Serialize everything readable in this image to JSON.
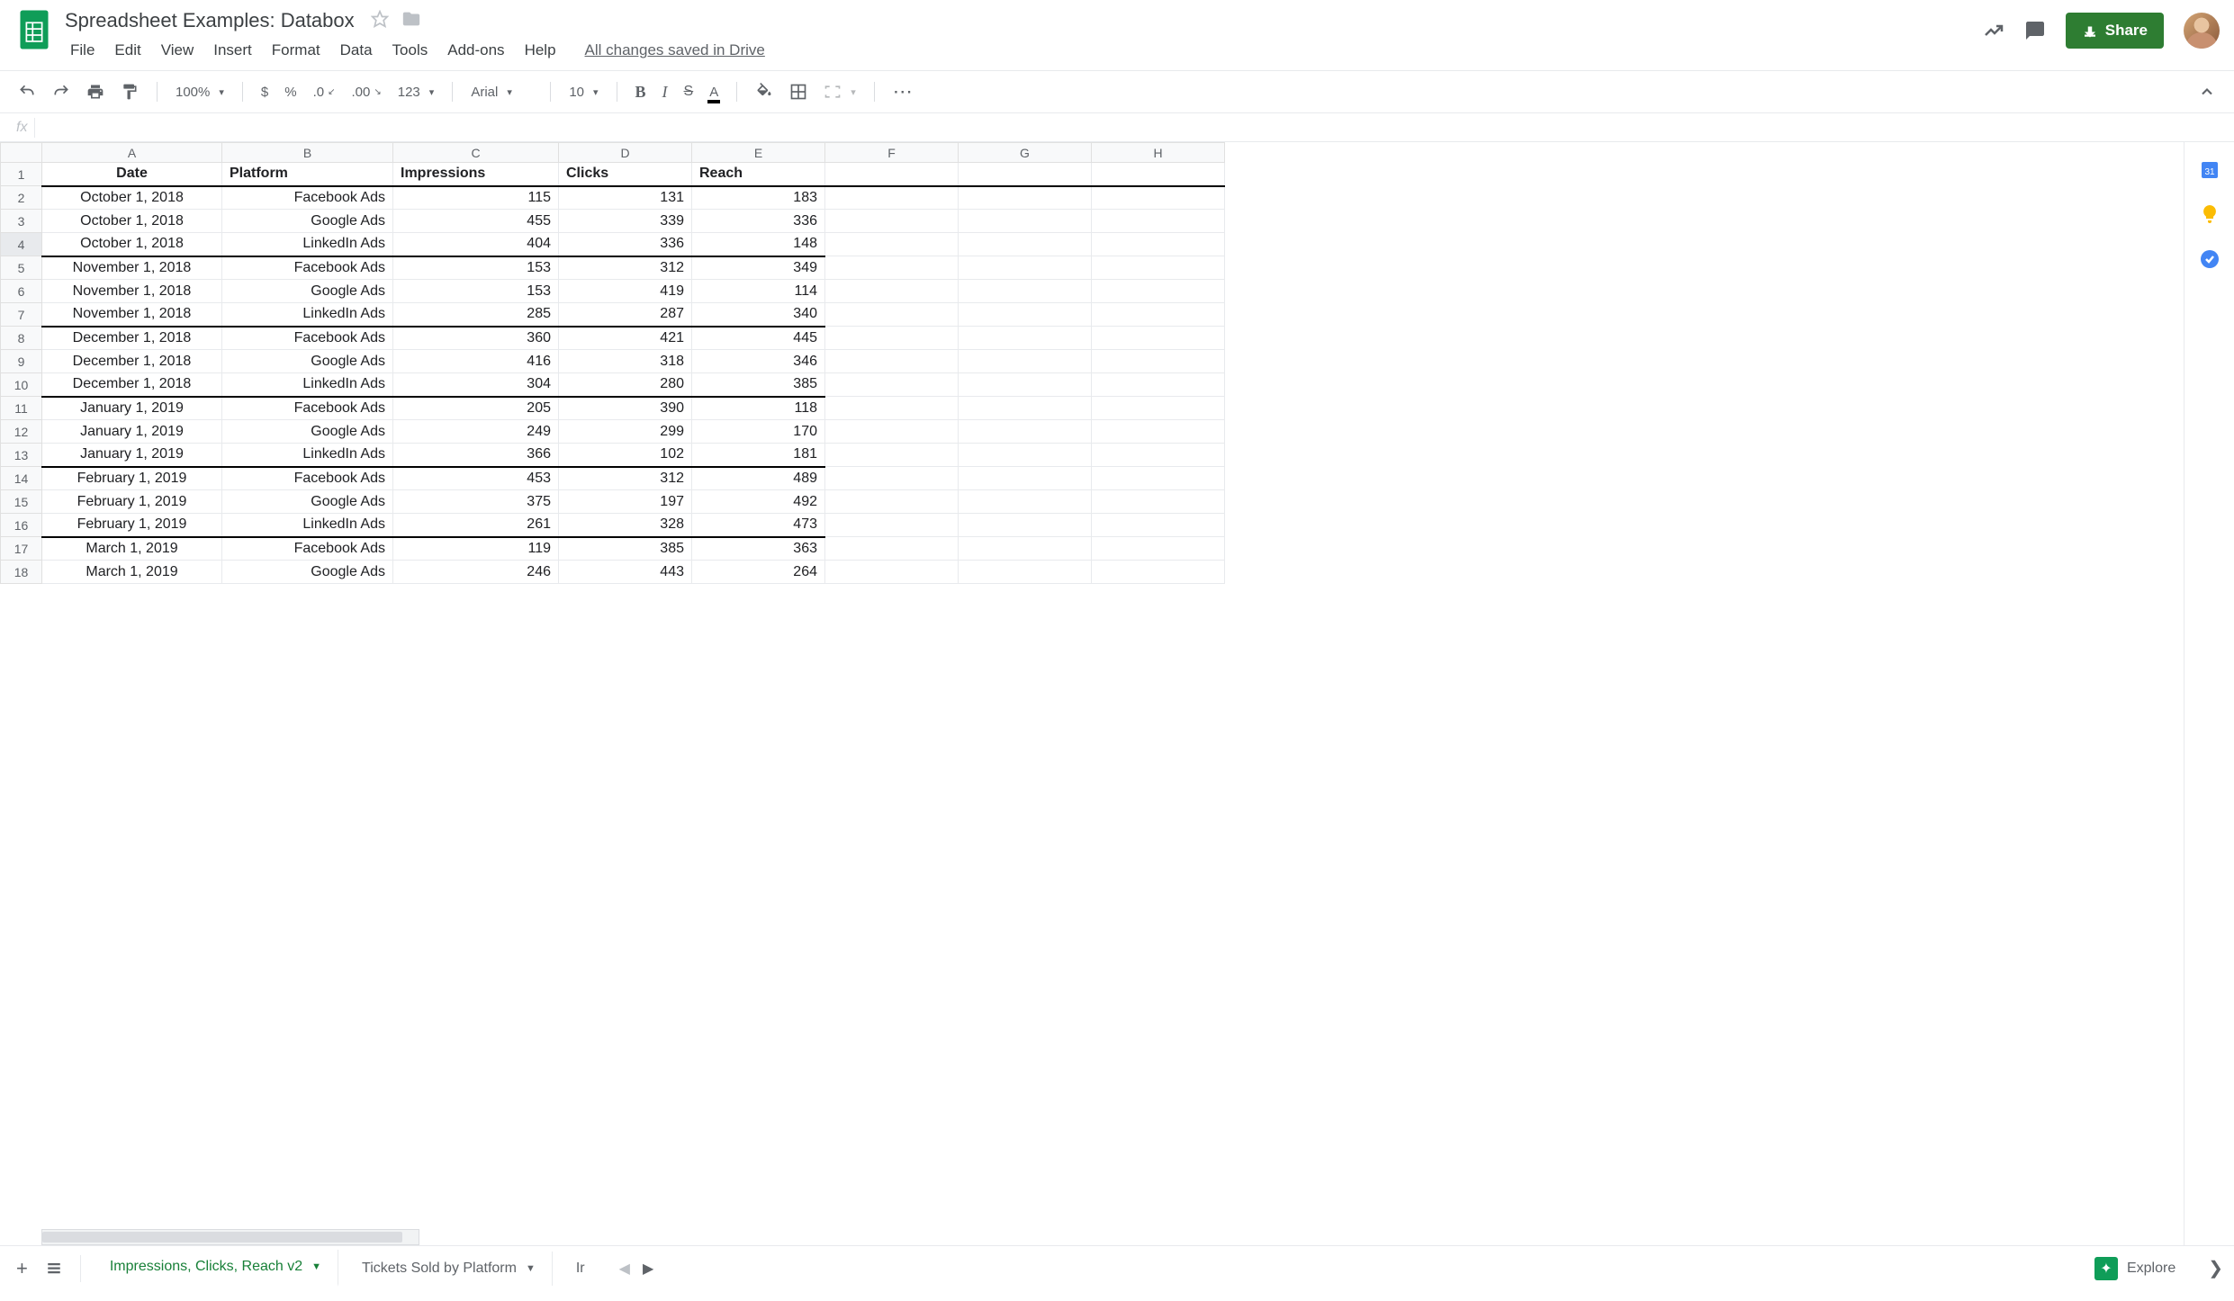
{
  "header": {
    "title": "Spreadsheet Examples: Databox",
    "saved_status": "All changes saved in Drive",
    "share_label": "Share"
  },
  "menu": [
    "File",
    "Edit",
    "View",
    "Insert",
    "Format",
    "Data",
    "Tools",
    "Add-ons",
    "Help"
  ],
  "toolbar": {
    "zoom": "100%",
    "currency": "$",
    "percent": "%",
    "dec_dec": ".0",
    "inc_dec": ".00",
    "num_fmt": "123",
    "font": "Arial",
    "size": "10",
    "more": "⋯"
  },
  "formula_bar": {
    "symbol": "fx",
    "value": ""
  },
  "columns": [
    "A",
    "B",
    "C",
    "D",
    "E",
    "F",
    "G",
    "H"
  ],
  "headers": [
    "Date",
    "Platform",
    "Impressions",
    "Clicks",
    "Reach"
  ],
  "rows": [
    {
      "n": 1,
      "hdr": true
    },
    {
      "n": 2,
      "d": "October 1, 2018",
      "p": "Facebook Ads",
      "i": 115,
      "c": 131,
      "r": 183
    },
    {
      "n": 3,
      "d": "October 1, 2018",
      "p": "Google Ads",
      "i": 455,
      "c": 339,
      "r": 336
    },
    {
      "n": 4,
      "d": "October 1, 2018",
      "p": "LinkedIn Ads",
      "i": 404,
      "c": 336,
      "r": 148,
      "ge": true
    },
    {
      "n": 5,
      "d": "November 1, 2018",
      "p": "Facebook Ads",
      "i": 153,
      "c": 312,
      "r": 349
    },
    {
      "n": 6,
      "d": "November 1, 2018",
      "p": "Google Ads",
      "i": 153,
      "c": 419,
      "r": 114
    },
    {
      "n": 7,
      "d": "November 1, 2018",
      "p": "LinkedIn Ads",
      "i": 285,
      "c": 287,
      "r": 340,
      "ge": true
    },
    {
      "n": 8,
      "d": "December 1, 2018",
      "p": "Facebook Ads",
      "i": 360,
      "c": 421,
      "r": 445
    },
    {
      "n": 9,
      "d": "December 1, 2018",
      "p": "Google Ads",
      "i": 416,
      "c": 318,
      "r": 346
    },
    {
      "n": 10,
      "d": "December 1, 2018",
      "p": "LinkedIn Ads",
      "i": 304,
      "c": 280,
      "r": 385,
      "ge": true
    },
    {
      "n": 11,
      "d": "January 1, 2019",
      "p": "Facebook Ads",
      "i": 205,
      "c": 390,
      "r": 118
    },
    {
      "n": 12,
      "d": "January 1, 2019",
      "p": "Google Ads",
      "i": 249,
      "c": 299,
      "r": 170
    },
    {
      "n": 13,
      "d": "January 1, 2019",
      "p": "LinkedIn Ads",
      "i": 366,
      "c": 102,
      "r": 181,
      "ge": true
    },
    {
      "n": 14,
      "d": "February 1, 2019",
      "p": "Facebook Ads",
      "i": 453,
      "c": 312,
      "r": 489
    },
    {
      "n": 15,
      "d": "February 1, 2019",
      "p": "Google Ads",
      "i": 375,
      "c": 197,
      "r": 492
    },
    {
      "n": 16,
      "d": "February 1, 2019",
      "p": "LinkedIn Ads",
      "i": 261,
      "c": 328,
      "r": 473,
      "ge": true
    },
    {
      "n": 17,
      "d": "March 1, 2019",
      "p": "Facebook Ads",
      "i": 119,
      "c": 385,
      "r": 363
    },
    {
      "n": 18,
      "d": "March 1, 2019",
      "p": "Google Ads",
      "i": 246,
      "c": 443,
      "r": 264
    }
  ],
  "tabs": {
    "active": "Impressions, Clicks, Reach v2",
    "other": "Tickets Sold by Platform",
    "truncated": "Ir"
  },
  "explore_label": "Explore",
  "chart_data": {
    "type": "table",
    "title": "Impressions, Clicks, Reach v2",
    "columns": [
      "Date",
      "Platform",
      "Impressions",
      "Clicks",
      "Reach"
    ],
    "records": [
      [
        "October 1, 2018",
        "Facebook Ads",
        115,
        131,
        183
      ],
      [
        "October 1, 2018",
        "Google Ads",
        455,
        339,
        336
      ],
      [
        "October 1, 2018",
        "LinkedIn Ads",
        404,
        336,
        148
      ],
      [
        "November 1, 2018",
        "Facebook Ads",
        153,
        312,
        349
      ],
      [
        "November 1, 2018",
        "Google Ads",
        153,
        419,
        114
      ],
      [
        "November 1, 2018",
        "LinkedIn Ads",
        285,
        287,
        340
      ],
      [
        "December 1, 2018",
        "Facebook Ads",
        360,
        421,
        445
      ],
      [
        "December 1, 2018",
        "Google Ads",
        416,
        318,
        346
      ],
      [
        "December 1, 2018",
        "LinkedIn Ads",
        304,
        280,
        385
      ],
      [
        "January 1, 2019",
        "Facebook Ads",
        205,
        390,
        118
      ],
      [
        "January 1, 2019",
        "Google Ads",
        249,
        299,
        170
      ],
      [
        "January 1, 2019",
        "LinkedIn Ads",
        366,
        102,
        181
      ],
      [
        "February 1, 2019",
        "Facebook Ads",
        453,
        312,
        489
      ],
      [
        "February 1, 2019",
        "Google Ads",
        375,
        197,
        492
      ],
      [
        "February 1, 2019",
        "LinkedIn Ads",
        261,
        328,
        473
      ],
      [
        "March 1, 2019",
        "Facebook Ads",
        119,
        385,
        363
      ],
      [
        "March 1, 2019",
        "Google Ads",
        246,
        443,
        264
      ]
    ]
  }
}
